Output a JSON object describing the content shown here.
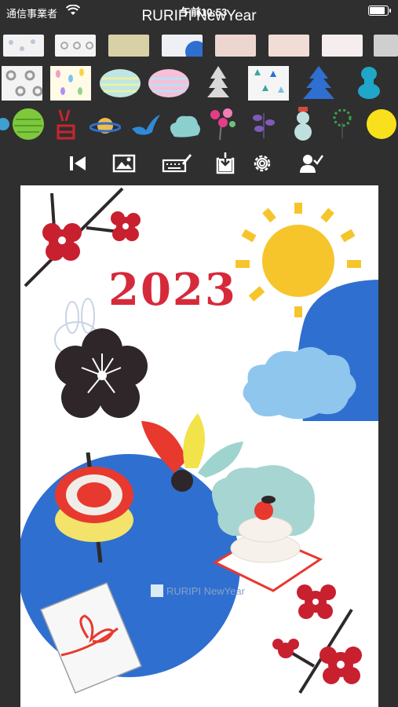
{
  "status_bar": {
    "carrier": "通信事業者",
    "time": "午前10:53"
  },
  "app": {
    "title": "RURIPI NewYear"
  },
  "watermark": {
    "text": "RURIPI NewYear"
  },
  "card": {
    "year": "2023"
  },
  "stamps_row1": [
    "pattern-1",
    "pattern-2",
    "pattern-3",
    "pattern-4",
    "pattern-5",
    "pattern-6",
    "pattern-7",
    "pattern-8"
  ],
  "stamps_row2": [
    "dots",
    "confetti",
    "stripes",
    "rainbow",
    "pine-tree",
    "triangles",
    "blue-tree",
    "kagami-ornament"
  ],
  "stamps_row3": [
    "green-ball",
    "calligraphy",
    "saturn",
    "bird",
    "cloud",
    "flowers",
    "berries",
    "snowman",
    "tree-sprout",
    "sun-yellow"
  ],
  "toolbar": [
    "back-start-icon",
    "image-icon",
    "keyboard-icon",
    "save-icon",
    "settings-icon",
    "user-check-icon"
  ],
  "colors": {
    "background": "#2f2f2f",
    "red": "#d62a3a",
    "blue": "#2f6fd0",
    "yellow": "#f6c52b",
    "sky": "#7fbde8"
  }
}
